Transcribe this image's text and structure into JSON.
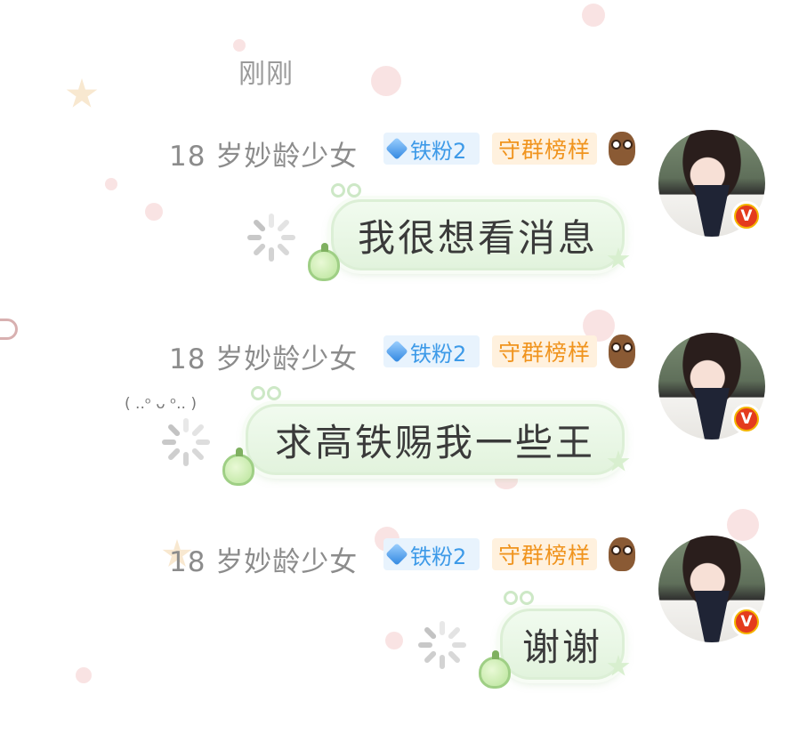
{
  "chat": {
    "timestamp": "刚刚",
    "messages": [
      {
        "sender": "18 岁妙龄少女",
        "fan_badge": "铁粉2",
        "guard_badge": "守群榜样",
        "text": "我很想看消息",
        "status": "sending"
      },
      {
        "sender": "18 岁妙龄少女",
        "fan_badge": "铁粉2",
        "guard_badge": "守群榜样",
        "text": "求高铁赐我一些王",
        "status": "sending"
      },
      {
        "sender": "18 岁妙龄少女",
        "fan_badge": "铁粉2",
        "guard_badge": "守群榜样",
        "text": "谢谢",
        "status": "sending"
      }
    ],
    "vip_mark": "V",
    "decor_text": "( ..ᵒ ᴗ ᵒ.. )",
    "colors": {
      "bubble_bg": "#e6f5e1",
      "name_text": "#8c8c8c",
      "fan_badge_text": "#3d9ae8",
      "guard_badge_text": "#f0941e",
      "vip_badge": "#e43b1d"
    }
  }
}
